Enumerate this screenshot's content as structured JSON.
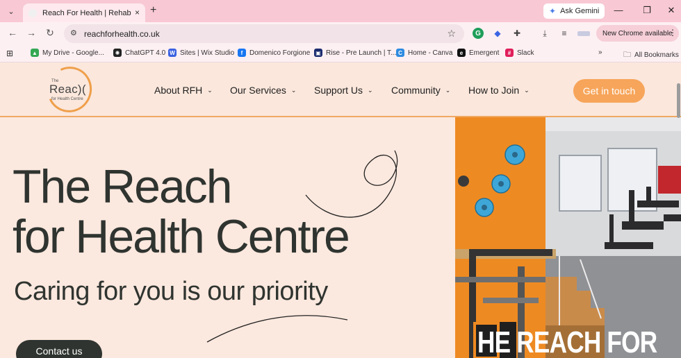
{
  "browser": {
    "tab": {
      "title": "Reach For Health | Rehabilitatio",
      "close_icon": "×"
    },
    "new_tab_icon": "+",
    "ask_gemini_label": "Ask Gemini",
    "window_controls": {
      "minimize": "—",
      "restore": "❐",
      "close": "✕"
    },
    "url": "reachforhealth.co.uk",
    "new_chrome_label": "New Chrome available",
    "bookmarks": [
      {
        "label": "My Drive - Google...",
        "icon": "drive-icon",
        "color": "#34a853"
      },
      {
        "label": "ChatGPT 4.0",
        "icon": "chatgpt-icon",
        "color": "#222222"
      },
      {
        "label": "Sites | Wix Studio",
        "icon": "wix-icon",
        "color": "#3c62e0"
      },
      {
        "label": "Domenico Forgione",
        "icon": "facebook-icon",
        "color": "#1877f2"
      },
      {
        "label": "Rise - Pre Launch | T...",
        "icon": "trello-icon",
        "color": "#1a2b6e"
      },
      {
        "label": "Home - Canva",
        "icon": "canva-icon",
        "color": "#2e8be0"
      },
      {
        "label": "Emergent",
        "icon": "emergent-icon",
        "color": "#111111"
      },
      {
        "label": "Slack",
        "icon": "slack-icon",
        "color": "#e01e5a"
      }
    ],
    "more_bookmarks": "»",
    "all_bookmarks_label": "All Bookmarks"
  },
  "site": {
    "logo": {
      "the": "The",
      "name": "Reac)(",
      "sub": "for Health Centre"
    },
    "nav": [
      {
        "label": "About RFH"
      },
      {
        "label": "Our Services"
      },
      {
        "label": "Support Us"
      },
      {
        "label": "Community"
      },
      {
        "label": "How to Join"
      }
    ],
    "cta_label": "Get in touch",
    "hero": {
      "title_line1": "The Reach",
      "title_line2": "for Health Centre",
      "subtitle": "Caring for you is our priority",
      "contact_label": "Contact us",
      "image_overlay_text": "HE REACH FOR"
    },
    "colors": {
      "accent": "#f7a55a",
      "background": "#fbe8de",
      "text": "#2f3430",
      "orange_wall": "#ee8a22"
    }
  }
}
